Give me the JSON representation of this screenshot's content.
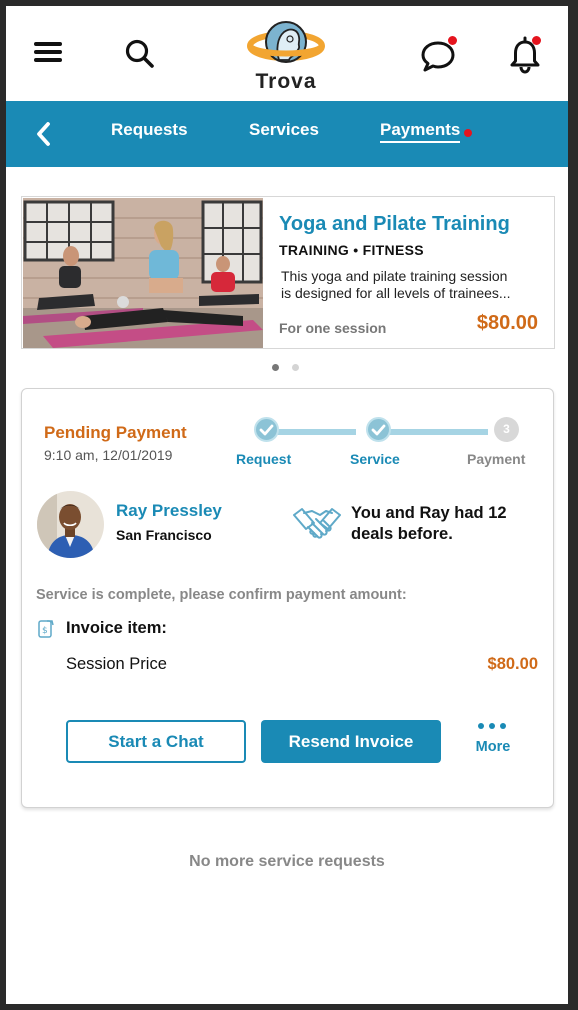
{
  "header": {
    "app_name": "Trova",
    "icons": [
      "hamburger-menu-icon",
      "search-icon",
      "chat-bubble-icon",
      "bell-icon"
    ],
    "notification_dot_color": "#e5141e"
  },
  "nav": {
    "tabs": [
      {
        "label": "Requests",
        "active": false
      },
      {
        "label": "Services",
        "active": false
      },
      {
        "label": "Payments",
        "active": true,
        "has_badge": true
      }
    ],
    "bar_color": "#1a8ab5"
  },
  "service": {
    "title": "Yoga and Pilate Training",
    "category": "TRAINING • FITNESS",
    "description_line1": "This yoga and pilate training session",
    "description_line2": "is designed for all levels of  trainees...",
    "session_label": "For one session",
    "price": "$80.00"
  },
  "carousel": {
    "pages": 2,
    "current": 1
  },
  "payment": {
    "status": "Pending Payment",
    "timestamp": "9:10 am, 12/01/2019",
    "steps": [
      {
        "label": "Request",
        "done": true
      },
      {
        "label": "Service",
        "done": true
      },
      {
        "label": "Payment",
        "done": false,
        "number": "3"
      }
    ],
    "person": {
      "name": "Ray Pressley",
      "city": "San Francisco"
    },
    "deals_line1": "You and Ray had 12",
    "deals_line2": "deals before.",
    "confirm_text": "Service is complete, please confirm payment amount:",
    "invoice_label": "Invoice item:",
    "item_label": "Session Price",
    "item_price": "$80.00",
    "buttons": {
      "chat": "Start a Chat",
      "resend": "Resend Invoice",
      "more": "More"
    }
  },
  "footer_text": "No more service requests",
  "colors": {
    "accent": "#1a8ab5",
    "price": "#d06a18",
    "muted": "#888888"
  }
}
